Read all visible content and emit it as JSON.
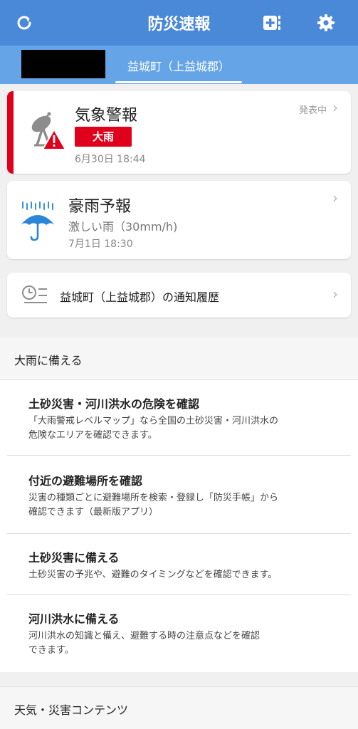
{
  "header": {
    "title": "防災速報",
    "icons": [
      "refresh-icon",
      "add-location-icon",
      "gear-icon"
    ],
    "color": "#4a88d8"
  },
  "tabs": {
    "active_label": "益城町（上益城郡）",
    "color": "#65a4e6"
  },
  "warning_card": {
    "title": "気象警報",
    "badge": "大雨",
    "time": "6月30日 18:44",
    "status": "発表中",
    "accent_color": "#e0001c"
  },
  "forecast_card": {
    "title": "豪雨予報",
    "description": "激しい雨（30mm/h)",
    "time": "7月1日 18:30"
  },
  "history_card": {
    "label": "益城町（上益城郡）の通知履歴"
  },
  "prepare_section": {
    "heading": "大雨に備える",
    "items": [
      {
        "title": "土砂災害・河川洪水の危険を確認",
        "description": "「大雨警戒レベルマップ」なら全国の土砂災害・河川洪水の\n危険なエリアを確認できます。"
      },
      {
        "title": "付近の避難場所を確認",
        "description": "災害の種類ごとに避難場所を検索・登録し「防災手帳」から\n確認できます（最新版アプリ）"
      },
      {
        "title": "土砂災害に備える",
        "description": "土砂災害の予兆や、避難のタイミングなどを確認できます。"
      },
      {
        "title": "河川洪水に備える",
        "description": "河川洪水の知識と備え、避難する時の注意点などを確認\nできます。"
      }
    ]
  },
  "contents_section": {
    "heading": "天気・災害コンテンツ"
  }
}
